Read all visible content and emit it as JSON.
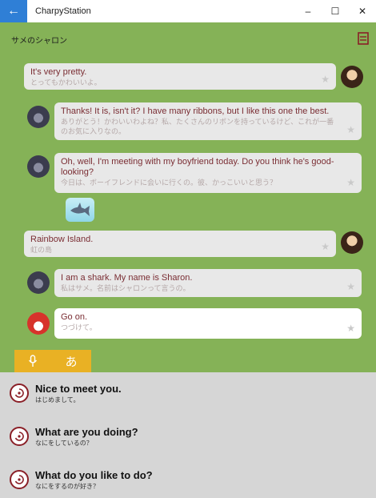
{
  "window": {
    "title": "CharpyStation",
    "back_icon": "back-arrow-icon",
    "controls": {
      "minimize": "–",
      "maximize": "☐",
      "close": "✕"
    }
  },
  "chat": {
    "title": "サメのシャロン",
    "menu_icon": "book-icon",
    "messages": [
      {
        "side": "right",
        "avatar": "girl-avatar",
        "text": "It's very pretty.",
        "translation": "とってもかわいいよ。"
      },
      {
        "side": "left",
        "avatar": "shark-avatar",
        "text": "Thanks! It is, isn't it? I have many ribbons, but I like this one the best.",
        "translation": "ありがとう！かわいいわよね？私、たくさんのリボンを持っているけど、これが一番のお気に入りなの。"
      },
      {
        "side": "left",
        "avatar": "shark-avatar",
        "text": "Oh, well, I'm meeting with my boyfriend today. Do you think he's good-looking?",
        "translation": "今日は、ボーイフレンドに会いに行くの。彼、かっこいいと思う？"
      },
      {
        "side": "right",
        "avatar": "girl-avatar",
        "text": "Rainbow Island.",
        "translation": "虹の島"
      },
      {
        "side": "left",
        "avatar": "shark-avatar",
        "text": "I am a shark. My name is Sharon.",
        "translation": "私はサメ。名前はシャロンって言うの。"
      },
      {
        "side": "left",
        "avatar": "red-character-avatar",
        "text": "Go on.",
        "translation": "つづけて。"
      }
    ]
  },
  "input": {
    "mic_icon": "microphone-icon",
    "kana_label": "あ"
  },
  "suggestions": [
    {
      "text": "Nice to meet you.",
      "translation": "はじめまして。"
    },
    {
      "text": "What are you doing?",
      "translation": "なにをしているの？"
    },
    {
      "text": "What do you like to do?",
      "translation": "なにをするのが好き？"
    }
  ],
  "colors": {
    "chat_bg": "#85b257",
    "accent_blue": "#2f7fd6",
    "input_tab": "#e9b124",
    "message_text": "#7a2d33",
    "suggestion_bg": "#d6d6d6"
  }
}
